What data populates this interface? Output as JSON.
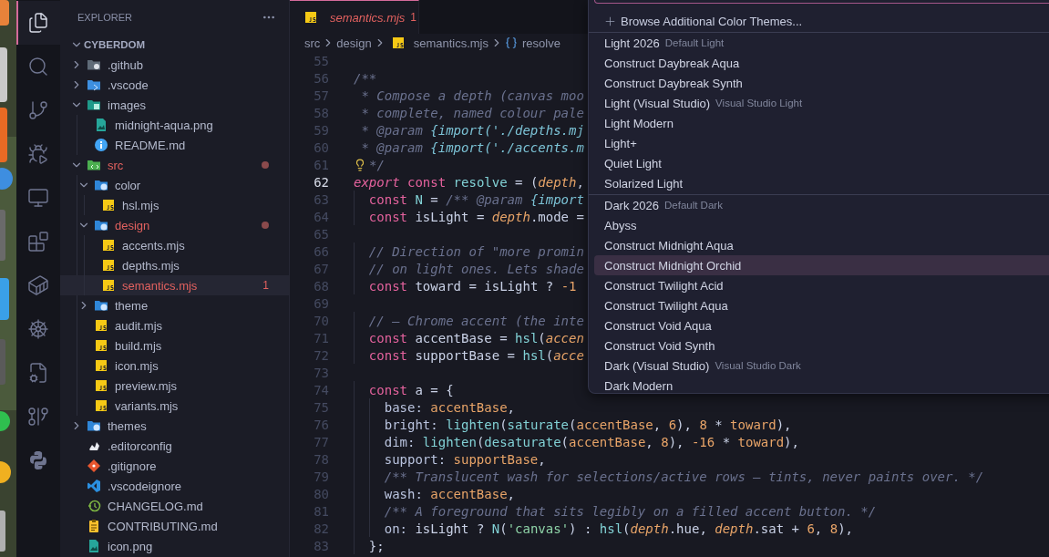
{
  "activity_bar": {
    "items": [
      {
        "selected": true
      },
      {
        "selected": false
      },
      {
        "selected": false
      },
      {
        "selected": false
      },
      {
        "selected": false
      },
      {
        "selected": false
      },
      {
        "selected": false
      },
      {
        "selected": false
      },
      {
        "selected": false
      },
      {
        "selected": false
      },
      {
        "selected": false
      }
    ]
  },
  "sidebar": {
    "title": "EXPLORER",
    "root": {
      "label": "CYBERDOM",
      "expanded": true
    },
    "items": [
      {
        "label": ".github",
        "kind": "folder",
        "expanded": false,
        "modified": false,
        "selected": false
      },
      {
        "label": ".vscode",
        "kind": "folder",
        "expanded": false,
        "modified": false,
        "selected": false
      },
      {
        "label": "images",
        "kind": "folder",
        "expanded": true,
        "modified": false,
        "selected": false,
        "children": [
          {
            "label": "midnight-aqua.png",
            "kind": "file",
            "modified": false,
            "selected": false
          },
          {
            "label": "README.md",
            "kind": "file",
            "modified": false,
            "selected": false
          }
        ]
      },
      {
        "label": "src",
        "kind": "folder",
        "expanded": true,
        "modified": true,
        "selected": false,
        "children": [
          {
            "label": "color",
            "kind": "folder",
            "expanded": true,
            "modified": false,
            "selected": false,
            "children": [
              {
                "label": "hsl.mjs",
                "kind": "file",
                "modified": false,
                "selected": false
              }
            ]
          },
          {
            "label": "design",
            "kind": "folder",
            "expanded": true,
            "modified": true,
            "selected": false,
            "children": [
              {
                "label": "accents.mjs",
                "kind": "file",
                "modified": false,
                "selected": false
              },
              {
                "label": "depths.mjs",
                "kind": "file",
                "modified": false,
                "selected": false
              },
              {
                "label": "semantics.mjs",
                "kind": "file",
                "modified": true,
                "selected": true,
                "problems": "1"
              }
            ]
          },
          {
            "label": "theme",
            "kind": "folder",
            "expanded": false,
            "modified": false,
            "selected": false
          },
          {
            "label": "audit.mjs",
            "kind": "file",
            "modified": false,
            "selected": false
          },
          {
            "label": "build.mjs",
            "kind": "file",
            "modified": false,
            "selected": false
          },
          {
            "label": "icon.mjs",
            "kind": "file",
            "modified": false,
            "selected": false
          },
          {
            "label": "preview.mjs",
            "kind": "file",
            "modified": false,
            "selected": false
          },
          {
            "label": "variants.mjs",
            "kind": "file",
            "modified": false,
            "selected": false
          }
        ]
      },
      {
        "label": "themes",
        "kind": "folder",
        "expanded": false,
        "modified": false,
        "selected": false
      },
      {
        "label": ".editorconfig",
        "kind": "file",
        "modified": false,
        "selected": false
      },
      {
        "label": ".gitignore",
        "kind": "file",
        "modified": false,
        "selected": false
      },
      {
        "label": ".vscodeignore",
        "kind": "file",
        "modified": false,
        "selected": false
      },
      {
        "label": "CHANGELOG.md",
        "kind": "file",
        "modified": false,
        "selected": false
      },
      {
        "label": "CONTRIBUTING.md",
        "kind": "file",
        "modified": false,
        "selected": false
      },
      {
        "label": "icon.png",
        "kind": "file",
        "modified": false,
        "selected": false
      }
    ]
  },
  "tabs": [
    {
      "label": "semantics.mjs",
      "problems": "1",
      "modified": true,
      "selected": true
    }
  ],
  "breadcrumbs": [
    "src",
    "design",
    "semantics.mjs",
    "resolve"
  ],
  "editor": {
    "lines": [
      {
        "number": "55",
        "current": false
      },
      {
        "number": "56",
        "current": false,
        "tokens": [
          {
            "kind": "com",
            "text": "/**"
          }
        ]
      },
      {
        "number": "57",
        "current": false,
        "tokens": [
          {
            "kind": "com",
            "text": " * Compose a depth (canvas moo"
          }
        ]
      },
      {
        "number": "58",
        "current": false,
        "tokens": [
          {
            "kind": "com",
            "text": " * complete, named colour pale"
          }
        ]
      },
      {
        "number": "59",
        "current": false,
        "tokens": [
          {
            "kind": "com",
            "text": " * @param "
          },
          {
            "kind": "comk",
            "text": "{import('./depths.mj"
          }
        ]
      },
      {
        "number": "60",
        "current": false,
        "tokens": [
          {
            "kind": "com",
            "text": " * @param "
          },
          {
            "kind": "comk",
            "text": "{import('./accents.m"
          }
        ]
      },
      {
        "number": "61",
        "current": false,
        "code_action": true,
        "tokens": [
          {
            "kind": "com",
            "text": "*/"
          }
        ]
      },
      {
        "number": "62",
        "current": true,
        "tokens": [
          {
            "kind": "kwi",
            "text": "export "
          },
          {
            "kind": "kw",
            "text": "const "
          },
          {
            "kind": "fn",
            "text": "resolve"
          },
          {
            "kind": "op",
            "text": " = ("
          },
          {
            "kind": "param",
            "text": "depth"
          },
          {
            "kind": "op",
            "text": ","
          }
        ]
      },
      {
        "number": "63",
        "current": false,
        "tokens": [
          {
            "kind": "kw",
            "text": "  const "
          },
          {
            "kind": "fn",
            "text": "N"
          },
          {
            "kind": "op",
            "text": " = "
          },
          {
            "kind": "com",
            "text": "/** @param "
          },
          {
            "kind": "comk",
            "text": "{import"
          }
        ]
      },
      {
        "number": "64",
        "current": false,
        "tokens": [
          {
            "kind": "kw",
            "text": "  const "
          },
          {
            "kind": "var",
            "text": "isLight"
          },
          {
            "kind": "op",
            "text": " = "
          },
          {
            "kind": "param",
            "text": "depth"
          },
          {
            "kind": "op",
            "text": ".mode ="
          }
        ]
      },
      {
        "number": "65",
        "current": false
      },
      {
        "number": "66",
        "current": false,
        "tokens": [
          {
            "kind": "com",
            "text": "  // Direction of \"more promin"
          }
        ]
      },
      {
        "number": "67",
        "current": false,
        "tokens": [
          {
            "kind": "com",
            "text": "  // on light ones. Lets shade"
          }
        ]
      },
      {
        "number": "68",
        "current": false,
        "tokens": [
          {
            "kind": "kw",
            "text": "  const "
          },
          {
            "kind": "var",
            "text": "toward"
          },
          {
            "kind": "op",
            "text": " = "
          },
          {
            "kind": "var",
            "text": "isLight"
          },
          {
            "kind": "op",
            "text": " ? "
          },
          {
            "kind": "num",
            "text": "-1"
          }
        ]
      },
      {
        "number": "69",
        "current": false
      },
      {
        "number": "70",
        "current": false,
        "tokens": [
          {
            "kind": "com",
            "text": "  // — Chrome accent (the inte"
          }
        ]
      },
      {
        "number": "71",
        "current": false,
        "tokens": [
          {
            "kind": "kw",
            "text": "  const "
          },
          {
            "kind": "var",
            "text": "accentBase"
          },
          {
            "kind": "op",
            "text": " = "
          },
          {
            "kind": "fn",
            "text": "hsl"
          },
          {
            "kind": "op",
            "text": "("
          },
          {
            "kind": "param",
            "text": "accen"
          }
        ]
      },
      {
        "number": "72",
        "current": false,
        "tokens": [
          {
            "kind": "kw",
            "text": "  const "
          },
          {
            "kind": "var",
            "text": "supportBase"
          },
          {
            "kind": "op",
            "text": " = "
          },
          {
            "kind": "fn",
            "text": "hsl"
          },
          {
            "kind": "op",
            "text": "("
          },
          {
            "kind": "param",
            "text": "acce"
          }
        ]
      },
      {
        "number": "73",
        "current": false
      },
      {
        "number": "74",
        "current": false,
        "tokens": [
          {
            "kind": "kw",
            "text": "  const "
          },
          {
            "kind": "var",
            "text": "a"
          },
          {
            "kind": "op",
            "text": " = {"
          }
        ]
      },
      {
        "number": "75",
        "current": false,
        "tokens": [
          {
            "kind": "prop",
            "text": "    base: "
          },
          {
            "kind": "val",
            "text": "accentBase"
          },
          {
            "kind": "op",
            "text": ","
          }
        ]
      },
      {
        "number": "76",
        "current": false,
        "tokens": [
          {
            "kind": "prop",
            "text": "    bright: "
          },
          {
            "kind": "fn",
            "text": "lighten"
          },
          {
            "kind": "op",
            "text": "("
          },
          {
            "kind": "fn",
            "text": "saturate"
          },
          {
            "kind": "op",
            "text": "("
          },
          {
            "kind": "val",
            "text": "accentBase"
          },
          {
            "kind": "op",
            "text": ", "
          },
          {
            "kind": "num",
            "text": "6"
          },
          {
            "kind": "op",
            "text": "), "
          },
          {
            "kind": "num",
            "text": "8"
          },
          {
            "kind": "op",
            "text": " * "
          },
          {
            "kind": "val",
            "text": "toward"
          },
          {
            "kind": "op",
            "text": "),"
          }
        ]
      },
      {
        "number": "77",
        "current": false,
        "tokens": [
          {
            "kind": "prop",
            "text": "    dim: "
          },
          {
            "kind": "fn",
            "text": "lighten"
          },
          {
            "kind": "op",
            "text": "("
          },
          {
            "kind": "fn",
            "text": "desaturate"
          },
          {
            "kind": "op",
            "text": "("
          },
          {
            "kind": "val",
            "text": "accentBase"
          },
          {
            "kind": "op",
            "text": ", "
          },
          {
            "kind": "num",
            "text": "8"
          },
          {
            "kind": "op",
            "text": "), "
          },
          {
            "kind": "num",
            "text": "-16"
          },
          {
            "kind": "op",
            "text": " * "
          },
          {
            "kind": "val",
            "text": "toward"
          },
          {
            "kind": "op",
            "text": "),"
          }
        ]
      },
      {
        "number": "78",
        "current": false,
        "tokens": [
          {
            "kind": "prop",
            "text": "    support: "
          },
          {
            "kind": "val",
            "text": "supportBase"
          },
          {
            "kind": "op",
            "text": ","
          }
        ]
      },
      {
        "number": "79",
        "current": false,
        "tokens": [
          {
            "kind": "com",
            "text": "    /** Translucent wash for selections/active rows — tints, never paints over. */"
          }
        ]
      },
      {
        "number": "80",
        "current": false,
        "tokens": [
          {
            "kind": "prop",
            "text": "    wash: "
          },
          {
            "kind": "val",
            "text": "accentBase"
          },
          {
            "kind": "op",
            "text": ","
          }
        ]
      },
      {
        "number": "81",
        "current": false,
        "tokens": [
          {
            "kind": "com",
            "text": "    /** A foreground that sits legibly on a filled accent button. */"
          }
        ]
      },
      {
        "number": "82",
        "current": false,
        "tokens": [
          {
            "kind": "prop",
            "text": "    on: "
          },
          {
            "kind": "var",
            "text": "isLight"
          },
          {
            "kind": "op",
            "text": " ? "
          },
          {
            "kind": "fn",
            "text": "N"
          },
          {
            "kind": "op",
            "text": "("
          },
          {
            "kind": "str",
            "text": "'canvas'"
          },
          {
            "kind": "op",
            "text": ") : "
          },
          {
            "kind": "fn",
            "text": "hsl"
          },
          {
            "kind": "op",
            "text": "("
          },
          {
            "kind": "param",
            "text": "depth"
          },
          {
            "kind": "op",
            "text": ".hue, "
          },
          {
            "kind": "param",
            "text": "depth"
          },
          {
            "kind": "op",
            "text": ".sat + "
          },
          {
            "kind": "num",
            "text": "6"
          },
          {
            "kind": "op",
            "text": ", "
          },
          {
            "kind": "num",
            "text": "8"
          },
          {
            "kind": "op",
            "text": "),"
          }
        ]
      },
      {
        "number": "83",
        "current": false,
        "tokens": [
          {
            "kind": "op",
            "text": "  };"
          }
        ]
      }
    ]
  },
  "quick_pick": {
    "browse_action": "Browse Additional Color Themes...",
    "groups": [
      {
        "items": [
          {
            "label": "Light 2026",
            "description": "Default Light",
            "selected": false
          },
          {
            "label": "Construct Daybreak Aqua",
            "selected": false
          },
          {
            "label": "Construct Daybreak Synth",
            "selected": false
          },
          {
            "label": "Light (Visual Studio)",
            "description": "Visual Studio Light",
            "selected": false
          },
          {
            "label": "Light Modern",
            "selected": false
          },
          {
            "label": "Light+",
            "selected": false
          },
          {
            "label": "Quiet Light",
            "selected": false
          },
          {
            "label": "Solarized Light",
            "selected": false
          }
        ]
      },
      {
        "items": [
          {
            "label": "Dark 2026",
            "description": "Default Dark",
            "selected": false
          },
          {
            "label": "Abyss",
            "selected": false
          },
          {
            "label": "Construct Midnight Aqua",
            "selected": false
          },
          {
            "label": "Construct Midnight Orchid",
            "selected": true
          },
          {
            "label": "Construct Twilight Acid",
            "selected": false
          },
          {
            "label": "Construct Twilight Aqua",
            "selected": false
          },
          {
            "label": "Construct Void Aqua",
            "selected": false
          },
          {
            "label": "Construct Void Synth",
            "selected": false
          },
          {
            "label": "Dark (Visual Studio)",
            "description": "Visual Studio Dark",
            "selected": false
          },
          {
            "label": "Dark Modern",
            "selected": false
          }
        ]
      }
    ]
  }
}
